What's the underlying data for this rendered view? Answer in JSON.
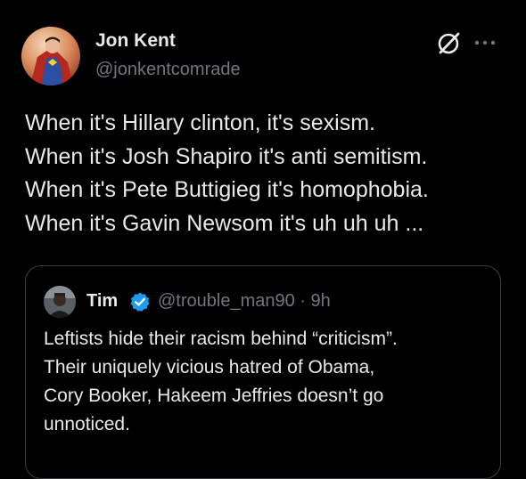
{
  "tweet": {
    "author": {
      "name": "Jon Kent",
      "handle": "@jonkentcomrade"
    },
    "icons": [
      "grok-icon",
      "more-options-icon"
    ],
    "text_lines": [
      "When it's Hillary clinton, it's sexism.",
      "When it's Josh Shapiro it's anti semitism.",
      "When it's Pete Buttigieg it's homophobia.",
      "When it's Gavin Newsom it's uh uh uh ..."
    ],
    "quoted": {
      "name": "Tim",
      "handle_time": "@trouble_man90 · 9h",
      "verified_icon": "verified-badge-icon",
      "text_lines": [
        "Leftists hide their racism behind “criticism”.",
        "Their uniquely vicious hatred of Obama,",
        "Cory Booker, Hakeem Jeffries doesn’t go",
        "unnoticed."
      ]
    }
  },
  "colors": {
    "background": "#000000",
    "text_primary": "#e7e9ea",
    "text_secondary": "#71767b",
    "border": "#3a3d40",
    "verified_blue": "#1d9bf0"
  }
}
